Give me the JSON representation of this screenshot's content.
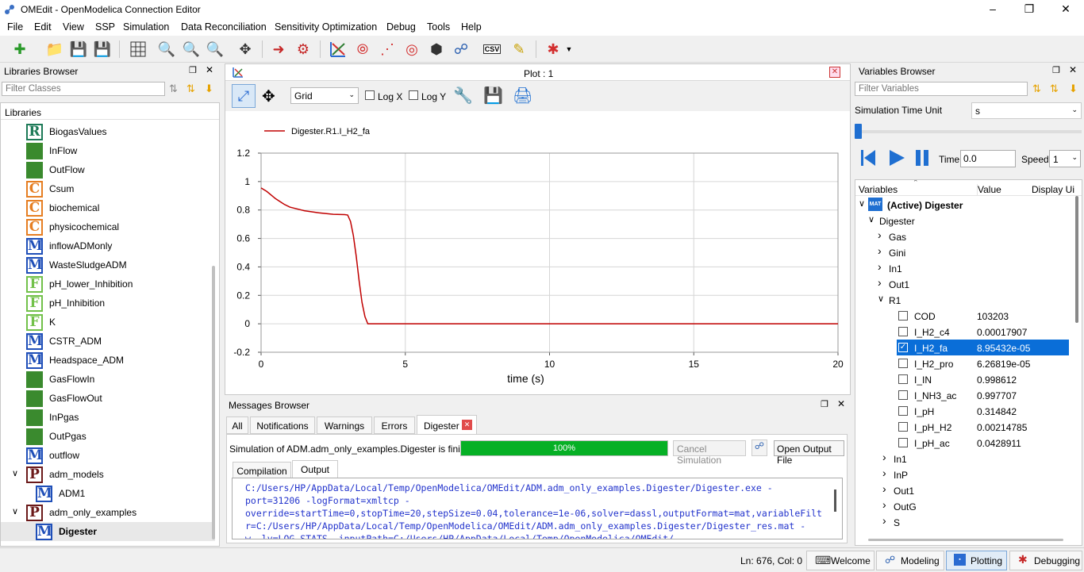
{
  "window": {
    "title": "OMEdit - OpenModelica Connection Editor"
  },
  "menu": [
    "File",
    "Edit",
    "View",
    "SSP",
    "Simulation",
    "Data Reconciliation",
    "Sensitivity Optimization",
    "Debug",
    "Tools",
    "Help"
  ],
  "toolbar": {
    "csv_label": "CSV"
  },
  "libraries": {
    "title": "Libraries Browser",
    "filter_placeholder": "Filter Classes",
    "header": "Libraries",
    "items": [
      {
        "icon": "R",
        "label": "BiogasValues"
      },
      {
        "icon": "G",
        "label": "InFlow"
      },
      {
        "icon": "G",
        "label": "OutFlow"
      },
      {
        "icon": "C",
        "label": "Csum"
      },
      {
        "icon": "C",
        "label": "biochemical"
      },
      {
        "icon": "C",
        "label": "physicochemical"
      },
      {
        "icon": "M",
        "label": "inflowADMonly"
      },
      {
        "icon": "M",
        "label": "WasteSludgeADM"
      },
      {
        "icon": "F",
        "label": "pH_lower_Inhibition"
      },
      {
        "icon": "F",
        "label": "pH_Inhibition"
      },
      {
        "icon": "F",
        "label": "K"
      },
      {
        "icon": "M",
        "label": "CSTR_ADM"
      },
      {
        "icon": "M",
        "label": "Headspace_ADM"
      },
      {
        "icon": "G",
        "label": "GasFlowIn"
      },
      {
        "icon": "G",
        "label": "GasFlowOut"
      },
      {
        "icon": "G",
        "label": "InPgas"
      },
      {
        "icon": "G",
        "label": "OutPgas"
      },
      {
        "icon": "M",
        "label": "outflow"
      },
      {
        "icon": "P",
        "label": "adm_models"
      },
      {
        "icon": "M",
        "label": "ADM1"
      },
      {
        "icon": "P",
        "label": "adm_only_examples"
      },
      {
        "icon": "M",
        "label": "Digester"
      }
    ]
  },
  "plot": {
    "title": "Plot : 1",
    "grid_select": "Grid",
    "logx": "Log X",
    "logy": "Log Y"
  },
  "chart_data": {
    "type": "line",
    "title": "",
    "xlabel": "time (s)",
    "ylabel": "",
    "xlim": [
      0,
      20
    ],
    "ylim": [
      -0.2,
      1.2
    ],
    "xticks": [
      "0",
      "5",
      "10",
      "15",
      "20"
    ],
    "yticks": [
      "1.2",
      "1",
      "0.8",
      "0.6",
      "0.4",
      "0.2",
      "0",
      "-0.2"
    ],
    "grid": true,
    "legend": "top-left",
    "series": [
      {
        "name": "Digester.R1.I_H2_fa",
        "color": "#c00000",
        "x": [
          0,
          0.2,
          0.5,
          0.8,
          1.0,
          1.5,
          2.0,
          2.5,
          2.9,
          3.0,
          3.1,
          3.2,
          3.3,
          3.4,
          3.5,
          3.6,
          3.7,
          4,
          10,
          15,
          20
        ],
        "y": [
          0.955,
          0.93,
          0.88,
          0.84,
          0.82,
          0.795,
          0.78,
          0.77,
          0.768,
          0.765,
          0.72,
          0.62,
          0.47,
          0.3,
          0.15,
          0.05,
          0.0,
          0.0,
          0.0,
          0.0,
          0.0
        ]
      }
    ]
  },
  "messages": {
    "title": "Messages Browser",
    "tabs": [
      "All",
      "Notifications",
      "Warnings",
      "Errors",
      "Digester"
    ],
    "status": "Simulation of ADM.adm_only_examples.Digester is finished.",
    "progress": 100,
    "progress_label": "100%",
    "cancel_label": "Cancel Simulation",
    "open_output_label": "Open Output File",
    "subtabs": [
      "Compilation",
      "Output"
    ],
    "output_lines": [
      "C:/Users/HP/AppData/Local/Temp/OpenModelica/OMEdit/ADM.adm_only_examples.Digester/Digester.exe -",
      "port=31206 -logFormat=xmltcp -",
      "override=startTime=0,stopTime=20,stepSize=0.04,tolerance=1e-06,solver=dassl,outputFormat=mat,variableFilt",
      "r=C:/Users/HP/AppData/Local/Temp/OpenModelica/OMEdit/ADM.adm_only_examples.Digester/Digester_res.mat -",
      "w -lv=LOG_STATS -inputPath=C:/Users/HP/AppData/Local/Temp/OpenModelica/OMEdit/"
    ]
  },
  "variables": {
    "title": "Variables Browser",
    "filter_placeholder": "Filter Variables",
    "time_unit_label": "Simulation Time Unit",
    "time_unit": "s",
    "time_label": "Time:",
    "time_value": "0.0",
    "speed_label": "Speed:",
    "speed_value": "1",
    "columns": [
      "Variables",
      "Value",
      "Display Ui"
    ],
    "tree": [
      {
        "label": "(Active) Digester",
        "indent": 0,
        "arrow": "v",
        "bold": true,
        "mat": true
      },
      {
        "label": "Digester",
        "indent": 1,
        "arrow": "v"
      },
      {
        "label": "Gas",
        "indent": 2,
        "arrow": ">"
      },
      {
        "label": "Gini",
        "indent": 2,
        "arrow": ">"
      },
      {
        "label": "In1",
        "indent": 2,
        "arrow": ">"
      },
      {
        "label": "Out1",
        "indent": 2,
        "arrow": ">"
      },
      {
        "label": "R1",
        "indent": 2,
        "arrow": "v"
      },
      {
        "label": "COD",
        "indent": 3,
        "check": false,
        "value": "103203"
      },
      {
        "label": "I_H2_c4",
        "indent": 3,
        "check": false,
        "value": "0.00017907"
      },
      {
        "label": "I_H2_fa",
        "indent": 3,
        "check": true,
        "value": "8.95432e-05",
        "selected": true
      },
      {
        "label": "I_H2_pro",
        "indent": 3,
        "check": false,
        "value": "6.26819e-05"
      },
      {
        "label": "I_IN",
        "indent": 3,
        "check": false,
        "value": "0.998612"
      },
      {
        "label": "I_NH3_ac",
        "indent": 3,
        "check": false,
        "value": "0.997707"
      },
      {
        "label": "I_pH",
        "indent": 3,
        "check": false,
        "value": "0.314842"
      },
      {
        "label": "I_pH_H2",
        "indent": 3,
        "check": false,
        "value": "0.00214785"
      },
      {
        "label": "I_pH_ac",
        "indent": 3,
        "check": false,
        "value": "0.0428911"
      },
      {
        "label": "In1",
        "indent": 2.5,
        "arrow": ">"
      },
      {
        "label": "InP",
        "indent": 2.5,
        "arrow": ">"
      },
      {
        "label": "Out1",
        "indent": 2.5,
        "arrow": ">"
      },
      {
        "label": "OutG",
        "indent": 2.5,
        "arrow": ">"
      },
      {
        "label": "S",
        "indent": 2.5,
        "arrow": ">"
      }
    ]
  },
  "status": {
    "position": "Ln: 676, Col: 0",
    "perspectives": [
      "Welcome",
      "Modeling",
      "Plotting",
      "Debugging"
    ]
  }
}
